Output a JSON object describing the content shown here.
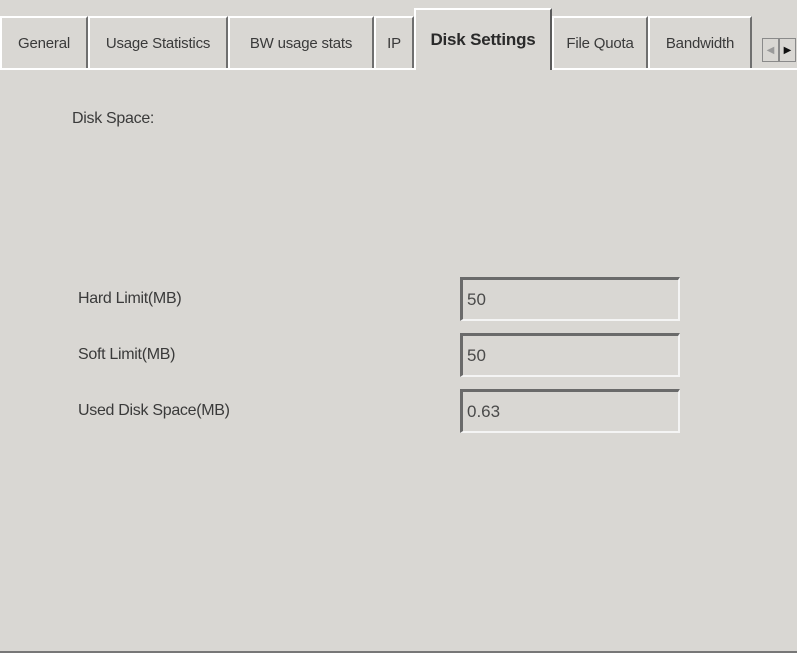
{
  "tabs": [
    {
      "label": "General"
    },
    {
      "label": "Usage Statistics"
    },
    {
      "label": "BW usage stats"
    },
    {
      "label": "IP"
    },
    {
      "label": "Disk Settings",
      "active": true
    },
    {
      "label": "File Quota"
    },
    {
      "label": "Bandwidth"
    }
  ],
  "panel": {
    "section_label": "Disk Space:",
    "fields": [
      {
        "label": "Hard Limit(MB)",
        "value": "50"
      },
      {
        "label": "Soft Limit(MB)",
        "value": "50"
      },
      {
        "label": "Used Disk Space(MB)",
        "value": "0.63"
      }
    ]
  },
  "icons": {
    "scroll_left": "arrow-left-icon",
    "scroll_right": "arrow-right-icon"
  }
}
